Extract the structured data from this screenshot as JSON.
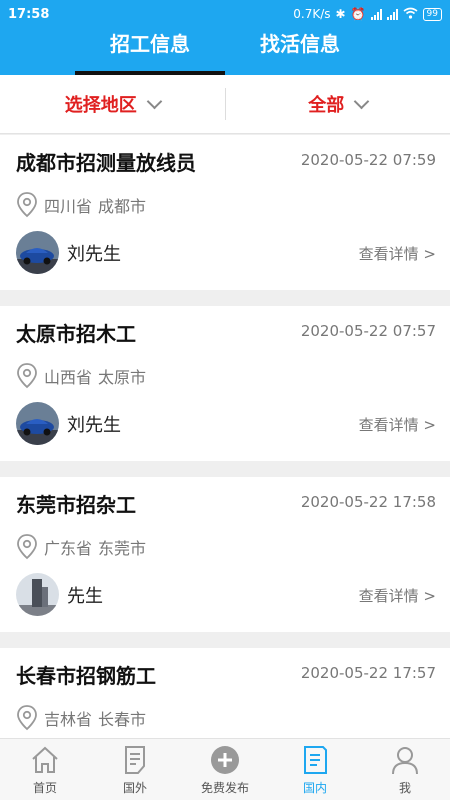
{
  "status": {
    "time": "17:58",
    "speed": "0.7K/s",
    "battery": "99"
  },
  "tabs": [
    {
      "label": "招工信息",
      "active": true
    },
    {
      "label": "找活信息",
      "active": false
    }
  ],
  "filter": {
    "region_label": "选择地区",
    "category_label": "全部"
  },
  "posts": [
    {
      "title": "成都市招测量放线员",
      "date": "2020-05-22 07:59",
      "province": "四川省",
      "city": "成都市",
      "user": "刘先生",
      "detail": "查看详情 >",
      "avatar": "car"
    },
    {
      "title": "太原市招木工",
      "date": "2020-05-22 07:57",
      "province": "山西省",
      "city": "太原市",
      "user": "刘先生",
      "detail": "查看详情 >",
      "avatar": "car"
    },
    {
      "title": "东莞市招杂工",
      "date": "2020-05-22 17:58",
      "province": "广东省",
      "city": "东莞市",
      "user": "先生",
      "detail": "查看详情 >",
      "avatar": "building"
    },
    {
      "title": "长春市招钢筋工",
      "date": "2020-05-22 17:57",
      "province": "吉林省",
      "city": "长春市",
      "user": "",
      "detail": "",
      "avatar": ""
    }
  ],
  "bottom_nav": [
    {
      "label": "首页",
      "icon": "home-icon",
      "active": false
    },
    {
      "label": "国外",
      "icon": "document-icon",
      "active": false
    },
    {
      "label": "免费发布",
      "icon": "plus-circle-icon",
      "active": false
    },
    {
      "label": "国内",
      "icon": "list-doc-icon",
      "active": true
    },
    {
      "label": "我",
      "icon": "person-icon",
      "active": false
    }
  ],
  "colors": {
    "primary": "#1ea7f0",
    "accent_red": "#e02020"
  }
}
